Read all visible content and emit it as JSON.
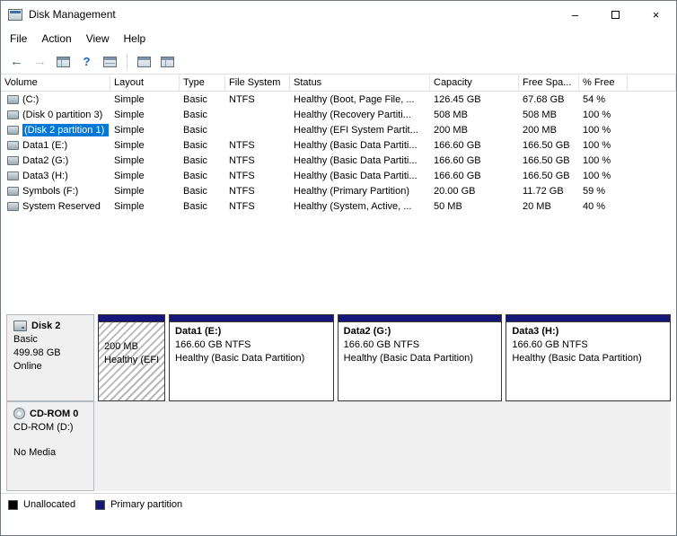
{
  "window": {
    "title": "Disk Management"
  },
  "icons": {
    "minimize": "–",
    "close": "×",
    "back": "←",
    "forward": "→",
    "help": "?"
  },
  "menu": {
    "file": "File",
    "action": "Action",
    "view": "View",
    "help": "Help"
  },
  "toolbar": {
    "icon_names": [
      "back",
      "forward",
      "show-console-tree",
      "help",
      "export-list",
      "popup-menu",
      "action-pane"
    ]
  },
  "table": {
    "columns": {
      "volume": "Volume",
      "layout": "Layout",
      "type": "Type",
      "fs": "File System",
      "status": "Status",
      "capacity": "Capacity",
      "free": "Free Spa...",
      "pct": "% Free"
    },
    "rows": [
      {
        "volume": "(C:)",
        "layout": "Simple",
        "type": "Basic",
        "fs": "NTFS",
        "status": "Healthy (Boot, Page File, ...",
        "capacity": "126.45 GB",
        "free": "67.68 GB",
        "pct": "54 %"
      },
      {
        "volume": "(Disk 0 partition 3)",
        "layout": "Simple",
        "type": "Basic",
        "fs": "",
        "status": "Healthy (Recovery Partiti...",
        "capacity": "508 MB",
        "free": "508 MB",
        "pct": "100 %"
      },
      {
        "volume": "(Disk 2 partition 1)",
        "layout": "Simple",
        "type": "Basic",
        "fs": "",
        "status": "Healthy (EFI System Partit...",
        "capacity": "200 MB",
        "free": "200 MB",
        "pct": "100 %",
        "selected": true
      },
      {
        "volume": "Data1 (E:)",
        "layout": "Simple",
        "type": "Basic",
        "fs": "NTFS",
        "status": "Healthy (Basic Data Partiti...",
        "capacity": "166.60 GB",
        "free": "166.50 GB",
        "pct": "100 %"
      },
      {
        "volume": "Data2 (G:)",
        "layout": "Simple",
        "type": "Basic",
        "fs": "NTFS",
        "status": "Healthy (Basic Data Partiti...",
        "capacity": "166.60 GB",
        "free": "166.50 GB",
        "pct": "100 %"
      },
      {
        "volume": "Data3 (H:)",
        "layout": "Simple",
        "type": "Basic",
        "fs": "NTFS",
        "status": "Healthy (Basic Data Partiti...",
        "capacity": "166.60 GB",
        "free": "166.50 GB",
        "pct": "100 %"
      },
      {
        "volume": "Symbols (F:)",
        "layout": "Simple",
        "type": "Basic",
        "fs": "NTFS",
        "status": "Healthy (Primary Partition)",
        "capacity": "20.00 GB",
        "free": "11.72 GB",
        "pct": "59 %"
      },
      {
        "volume": "System Reserved",
        "layout": "Simple",
        "type": "Basic",
        "fs": "NTFS",
        "status": "Healthy (System, Active, ...",
        "capacity": "50 MB",
        "free": "20 MB",
        "pct": "40 %"
      }
    ]
  },
  "graphical": {
    "disk": {
      "name": "Disk 2",
      "kind": "Basic",
      "size": "499.98 GB",
      "status": "Online",
      "partitions": [
        {
          "label": "",
          "size": "200 MB",
          "status": "Healthy (EFI",
          "selected": true
        },
        {
          "label": "Data1  (E:)",
          "size": "166.60 GB NTFS",
          "status": "Healthy (Basic Data Partition)",
          "selected": false
        },
        {
          "label": "Data2  (G:)",
          "size": "166.60 GB NTFS",
          "status": "Healthy (Basic Data Partition)",
          "selected": false
        },
        {
          "label": "Data3  (H:)",
          "size": "166.60 GB NTFS",
          "status": "Healthy (Basic Data Partition)",
          "selected": false
        }
      ]
    },
    "cdrom": {
      "name": "CD-ROM 0",
      "drive": "CD-ROM (D:)",
      "media": "No Media"
    }
  },
  "legend": {
    "unallocated": {
      "label": "Unallocated",
      "color": "#000000"
    },
    "primary": {
      "label": "Primary partition",
      "color": "#161679"
    }
  },
  "colors": {
    "selection": "#0078d7",
    "primary_partition": "#161679",
    "unallocated": "#000000"
  }
}
